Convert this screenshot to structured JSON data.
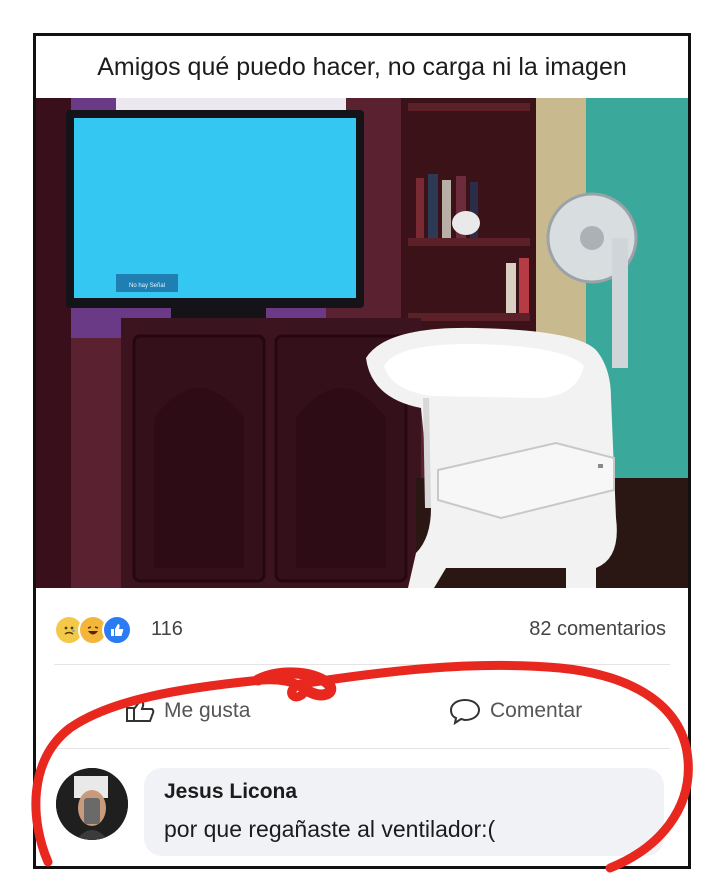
{
  "post": {
    "caption": "Amigos qué puedo hacer, no carga ni la imagen"
  },
  "photo": {
    "tv_screen_text": "No hay Señal"
  },
  "reactions": {
    "icons": [
      "sad-face-icon",
      "laughing-face-icon",
      "thumbs-up-icon"
    ],
    "count": "116",
    "comments": "82 comentarios"
  },
  "actions": {
    "like_label": "Me gusta",
    "comment_label": "Comentar"
  },
  "comment": {
    "author": "Jesus Licona",
    "text": "por que regañaste al ventilador:("
  },
  "colors": {
    "annotation_red": "#e8281f",
    "like_blue": "#2b7bf2",
    "bubble_bg": "#f0f2f5",
    "tv_screen": "#33c7f2"
  }
}
